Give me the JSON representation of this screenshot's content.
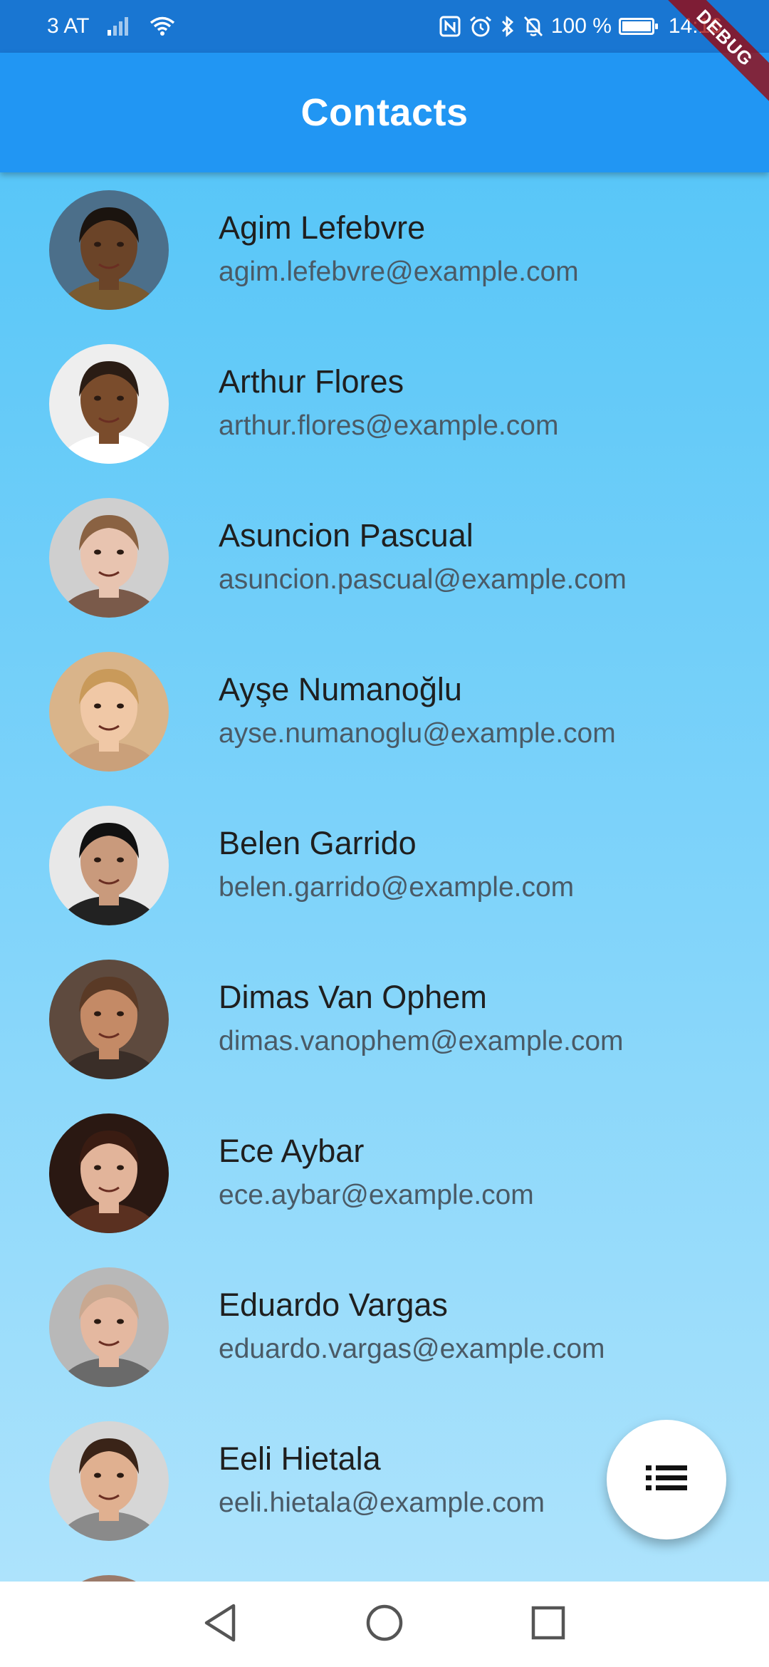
{
  "status_bar": {
    "carrier": "3 AT",
    "battery": "100 %",
    "time": "14:16",
    "icons": [
      "signal-icon",
      "wifi-icon",
      "nfc-icon",
      "alarm-icon",
      "bluetooth-icon",
      "notifications-off-icon",
      "battery-icon"
    ]
  },
  "app_bar": {
    "title": "Contacts"
  },
  "debug_banner": "DEBUG",
  "contacts": [
    {
      "name": "Agim Lefebvre",
      "email": "agim.lefebvre@example.com",
      "skin": "#6b4428",
      "hair": "#1b140f",
      "bg": "#4c6f8a",
      "shirt": "#7a5a30"
    },
    {
      "name": "Arthur Flores",
      "email": "arthur.flores@example.com",
      "skin": "#7a4c2c",
      "hair": "#2a1c14",
      "bg": "#eeeeee",
      "shirt": "#ffffff"
    },
    {
      "name": "Asuncion Pascual",
      "email": "asuncion.pascual@example.com",
      "skin": "#e8c4b0",
      "hair": "#8a6242",
      "bg": "#cfcfcf",
      "shirt": "#7a5a4a"
    },
    {
      "name": "Ayşe Numanoğlu",
      "email": "ayse.numanoglu@example.com",
      "skin": "#f0c8a6",
      "hair": "#c99a5a",
      "bg": "#d9b48a",
      "shirt": "#caa07a"
    },
    {
      "name": "Belen Garrido",
      "email": "belen.garrido@example.com",
      "skin": "#c99a7c",
      "hair": "#111111",
      "bg": "#e8e8e8",
      "shirt": "#222222"
    },
    {
      "name": "Dimas Van Ophem",
      "email": "dimas.vanophem@example.com",
      "skin": "#c48a66",
      "hair": "#5a3a26",
      "bg": "#5e4a3e",
      "shirt": "#3a2e28"
    },
    {
      "name": "Ece Aybar",
      "email": "ece.aybar@example.com",
      "skin": "#e2b49a",
      "hair": "#3a1c12",
      "bg": "#2a1812",
      "shirt": "#5a3020"
    },
    {
      "name": "Eduardo Vargas",
      "email": "eduardo.vargas@example.com",
      "skin": "#e4b8a0",
      "hair": "#c9a890",
      "bg": "#b8b8b8",
      "shirt": "#6a6a6a"
    },
    {
      "name": "Eeli Hietala",
      "email": "eeli.hietala@example.com",
      "skin": "#e0b090",
      "hair": "#3a2418",
      "bg": "#d6d6d6",
      "shirt": "#8a8a8a"
    },
    {
      "name": "",
      "email": "",
      "skin": "#c08a6a",
      "hair": "#2a1a12",
      "bg": "#9a7a6a",
      "shirt": "#4a3a30"
    }
  ],
  "fab": {
    "icon": "list-icon"
  },
  "nav_bar": {
    "back_icon": "back-triangle-icon",
    "home_icon": "home-circle-icon",
    "recents_icon": "recents-square-icon"
  }
}
